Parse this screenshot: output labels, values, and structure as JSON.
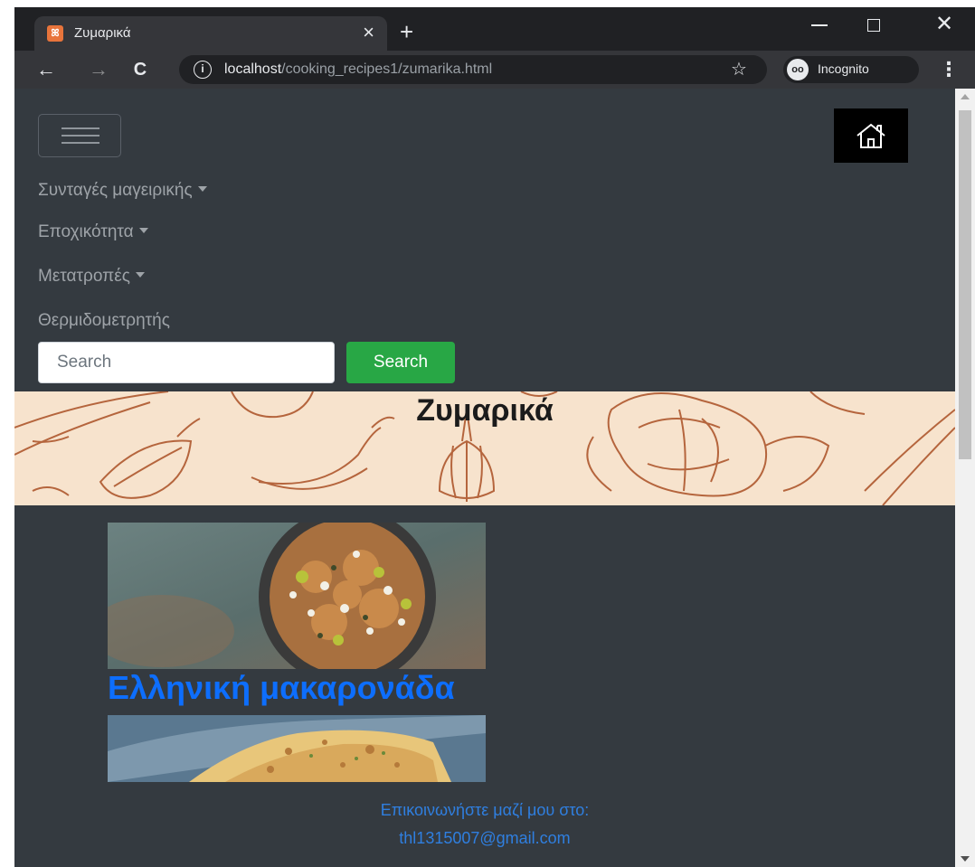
{
  "browser": {
    "tab_title": "Ζυμαρικά",
    "tab_close": "×",
    "new_tab": "+",
    "window_close": "✕",
    "url_host": "localhost",
    "url_path": "/cooking_recipes1/zumarika.html",
    "incognito_label": "Incognito"
  },
  "navbar": {
    "items": [
      {
        "label": "Συνταγές μαγειρικής",
        "dropdown": true
      },
      {
        "label": "Εποχικότητα",
        "dropdown": true
      },
      {
        "label": "Μετατροπές",
        "dropdown": true
      },
      {
        "label": "Θερμιδομετρητής",
        "dropdown": false
      }
    ],
    "search_placeholder": "Search",
    "search_button": "Search"
  },
  "banner": {
    "title": "Ζυμαρικά"
  },
  "recipes": [
    {
      "title": "Ελληνική μακαρονάδα"
    }
  ],
  "footer": {
    "contact_label": "Επικοινωνήστε μαζί μου στο:",
    "email": "thl1315007@gmail.com"
  },
  "colors": {
    "page_bg": "#343a40",
    "link": "#0d6efd",
    "search_button": "#28a745",
    "banner_bg": "#f7e3cd"
  }
}
